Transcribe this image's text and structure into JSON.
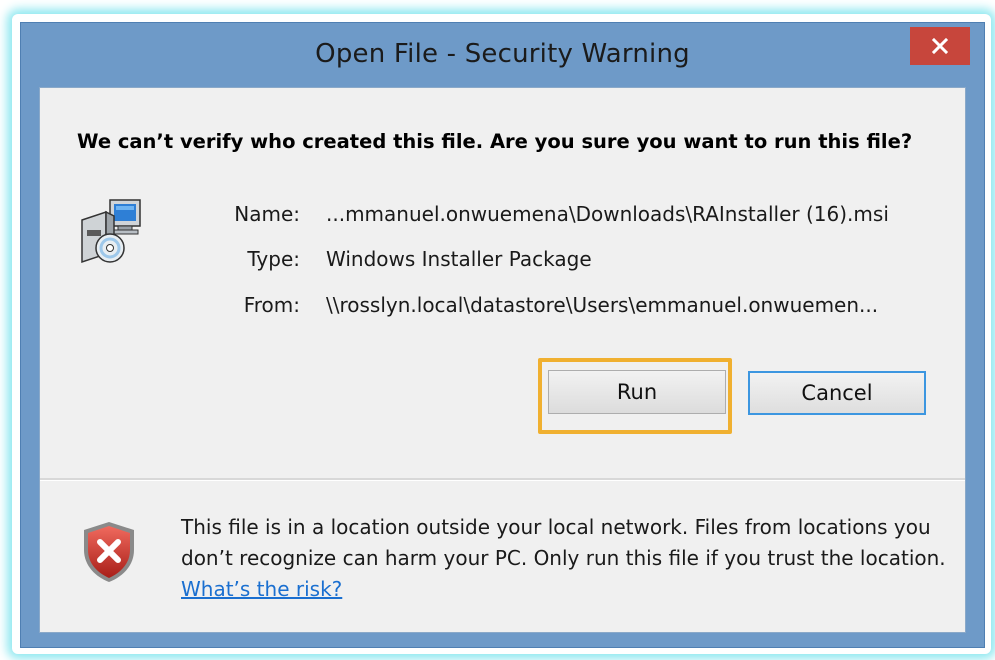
{
  "window": {
    "title": "Open File - Security Warning",
    "close_icon": "close-icon",
    "close_color": "#c7463c"
  },
  "dialog": {
    "headline": "We can’t verify who created this file. Are you sure you want to run this file?",
    "file_icon": "installer-package-icon",
    "details": [
      {
        "label": "Name:",
        "value": "...mmanuel.onwuemena\\Downloads\\RAInstaller (16).msi"
      },
      {
        "label": "Type:",
        "value": "Windows Installer Package"
      },
      {
        "label": "From:",
        "value": "\\\\rosslyn.local\\datastore\\Users\\emmanuel.onwuemen..."
      }
    ],
    "buttons": {
      "run": "Run",
      "cancel": "Cancel"
    },
    "highlight_color": "#f0b030"
  },
  "footer": {
    "shield_icon": "security-shield-icon",
    "warning_text": "This file is in a location outside your local network. Files from locations you don’t recognize can harm your PC. Only run this file if you trust the location.",
    "risk_link": "What’s the risk?"
  }
}
